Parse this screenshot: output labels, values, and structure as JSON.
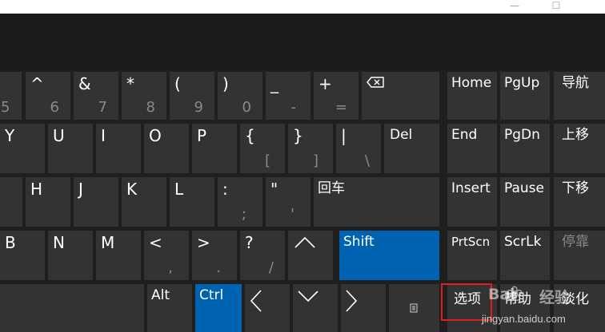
{
  "window": {
    "minimize_glyph": "—",
    "maximize_glyph": "☐"
  },
  "keys": {
    "five": {
      "p": "",
      "s": "5"
    },
    "six": {
      "p": "^",
      "s": "6"
    },
    "seven": {
      "p": "&",
      "s": "7"
    },
    "eight": {
      "p": "*",
      "s": "8"
    },
    "nine": {
      "p": "(",
      "s": "9"
    },
    "zero": {
      "p": ")",
      "s": "0"
    },
    "minus": {
      "p": "_",
      "s": "-"
    },
    "equals": {
      "p": "+",
      "s": "="
    },
    "backspace": {
      "icon": "backspace-icon"
    },
    "y": "Y",
    "u": "U",
    "i": "I",
    "o": "O",
    "p": "P",
    "lbracket": {
      "p": "{",
      "s": "["
    },
    "rbracket": {
      "p": "}",
      "s": "]"
    },
    "backslash": {
      "p": "|",
      "s": "\\"
    },
    "del": "Del",
    "h": "H",
    "j": "J",
    "k": "K",
    "l": "L",
    "semicolon": {
      "p": ":",
      "s": ";"
    },
    "quote": {
      "p": "\"",
      "s": "'"
    },
    "enter": "回车",
    "b": "B",
    "n": "N",
    "m": "M",
    "comma": {
      "p": "<",
      "s": ","
    },
    "period": {
      "p": ">",
      "s": "."
    },
    "slash": {
      "p": "?",
      "s": "/"
    },
    "up": {
      "icon": "arrow-up-icon"
    },
    "shift": "Shift",
    "alt": "Alt",
    "ctrl": "Ctrl",
    "left": {
      "icon": "arrow-left-icon"
    },
    "down": {
      "icon": "arrow-down-icon"
    },
    "right": {
      "icon": "arrow-right-icon"
    },
    "menu": {
      "icon": "menu-key-icon"
    }
  },
  "nav_keys": {
    "home": "Home",
    "pgup": "PgUp",
    "nav": "导航",
    "end": "End",
    "pgdn": "PgDn",
    "moveup": "上移",
    "insert": "Insert",
    "pause": "Pause",
    "movedown": "下移",
    "prtscn": "PrtScn",
    "scrlk": "ScrLk",
    "dock": "停靠",
    "options": "选项",
    "help": "帮助",
    "fade": "淡化"
  },
  "watermark": {
    "brand_left": "Bai",
    "brand_right": "经验",
    "url": "jingyan.baidu.com"
  },
  "colors": {
    "key": "#333333",
    "accent_blue": "#0063b1",
    "highlight": "#e02020"
  }
}
